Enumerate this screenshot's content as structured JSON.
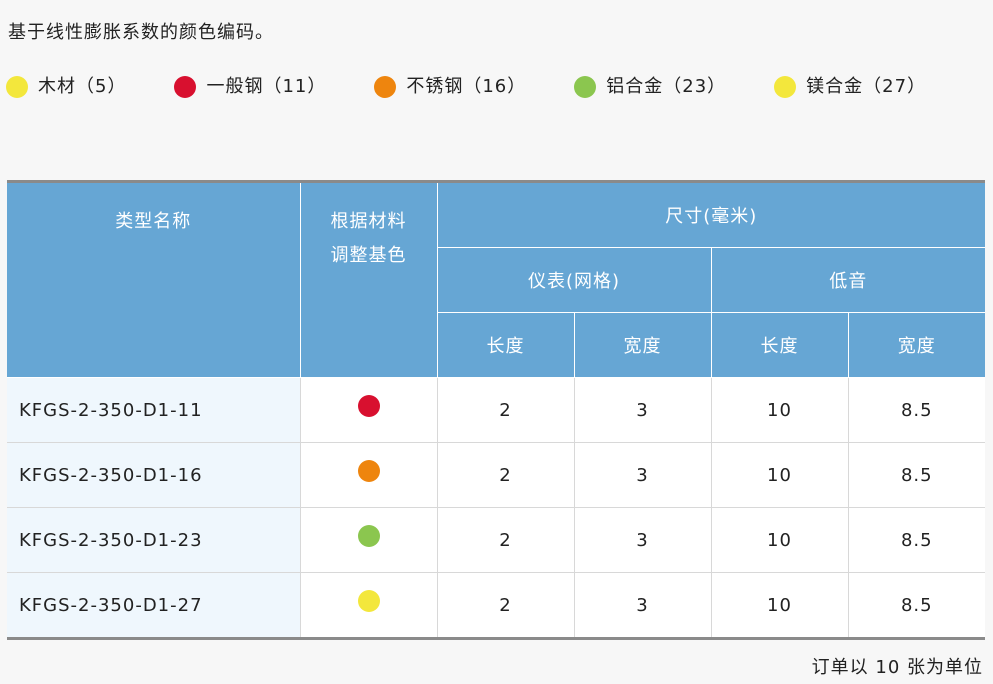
{
  "intro": "基于线性膨胀系数的颜色编码。",
  "legend": [
    {
      "label": "木材（5）",
      "color": "#f3e73c"
    },
    {
      "label": "一般钢（11）",
      "color": "#d8102f"
    },
    {
      "label": "不锈钢（16）",
      "color": "#ee850e"
    },
    {
      "label": "铝合金（23）",
      "color": "#8bc64f"
    },
    {
      "label": "镁合金（27）",
      "color": "#f3e73c"
    }
  ],
  "table": {
    "headers": {
      "type_name": "类型名称",
      "base_color": "根据材料调整基色",
      "size": "尺寸(毫米)",
      "meter": "仪表(网格)",
      "bass": "低音",
      "length": "长度",
      "width": "宽度"
    },
    "rows": [
      {
        "name": "KFGS-2-350-D1-11",
        "color": "#d8102f",
        "meter_length": "2",
        "meter_width": "3",
        "bass_length": "10",
        "bass_width": "8.5"
      },
      {
        "name": "KFGS-2-350-D1-16",
        "color": "#ee850e",
        "meter_length": "2",
        "meter_width": "3",
        "bass_length": "10",
        "bass_width": "8.5"
      },
      {
        "name": "KFGS-2-350-D1-23",
        "color": "#8bc64f",
        "meter_length": "2",
        "meter_width": "3",
        "bass_length": "10",
        "bass_width": "8.5"
      },
      {
        "name": "KFGS-2-350-D1-27",
        "color": "#f3e73c",
        "meter_length": "2",
        "meter_width": "3",
        "bass_length": "10",
        "bass_width": "8.5"
      }
    ]
  },
  "footnote": "订单以 10 张为单位"
}
